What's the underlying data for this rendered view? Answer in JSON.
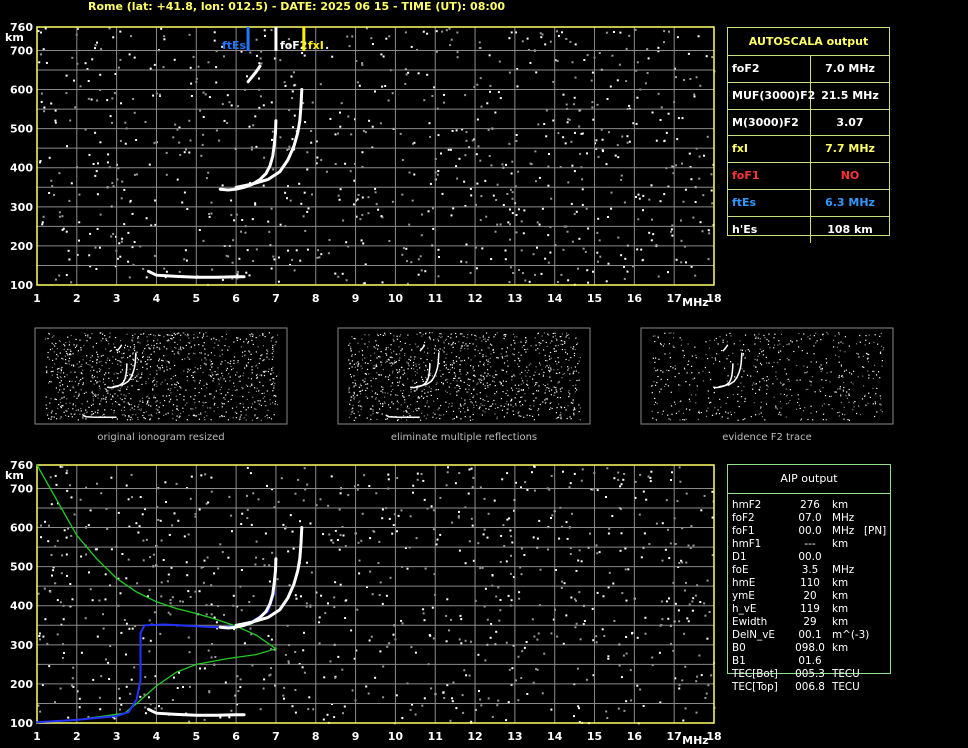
{
  "header": {
    "title": "Rome (lat: +41.8, lon: 012.5) - DATE: 2025 06 15 - TIME (UT): 08:00"
  },
  "colors": {
    "grid": "#8a8a8a",
    "frame": "#ffff66",
    "trace": "#ffffff",
    "profile_blue": "#2233ff",
    "profile_green": "#22cc22",
    "ftEs_marker": "#2277ff",
    "foF2_marker": "#ffffff",
    "fxI_marker": "#ffee00"
  },
  "main_ionogram": {
    "y_unit": "km",
    "x_unit": "MHz",
    "markers": [
      "ftEs",
      "foF2",
      "fxI"
    ]
  },
  "autoscala": {
    "title": "AUTOSCALA output",
    "rows": [
      {
        "label": "foF2",
        "value": "7.0 MHz",
        "color": "#ffffff"
      },
      {
        "label": "MUF(3000)F2",
        "value": "21.5 MHz",
        "color": "#ffffff"
      },
      {
        "label": "M(3000)F2",
        "value": "3.07",
        "color": "#ffffff"
      },
      {
        "label": "fxI",
        "value": "7.7 MHz",
        "color": "#ffff66"
      },
      {
        "label": "foF1",
        "value": "NO",
        "color": "#ff3333"
      },
      {
        "label": "ftEs",
        "value": "6.3 MHz",
        "color": "#3399ff"
      },
      {
        "label": "h'Es",
        "value": "108     km",
        "color": "#ffffff"
      }
    ]
  },
  "thumbnails": [
    {
      "caption": "original ionogram resized"
    },
    {
      "caption": "eliminate multiple reflections"
    },
    {
      "caption": "evidence F2 trace"
    }
  ],
  "aip": {
    "title": "AIP output",
    "rows": [
      {
        "name": "hmF2",
        "value": "276",
        "unit": "km",
        "extra": ""
      },
      {
        "name": "foF2",
        "value": "07.0",
        "unit": "MHz",
        "extra": ""
      },
      {
        "name": "foF1",
        "value": "00.0",
        "unit": "MHz",
        "extra": "[PN]"
      },
      {
        "name": "hmF1",
        "value": "---",
        "unit": "km",
        "extra": ""
      },
      {
        "name": "D1",
        "value": "00.0",
        "unit": "",
        "extra": ""
      },
      {
        "name": "foE",
        "value": "3.5",
        "unit": "MHz",
        "extra": ""
      },
      {
        "name": "hmE",
        "value": "110",
        "unit": "km",
        "extra": ""
      },
      {
        "name": "ymE",
        "value": "20",
        "unit": "km",
        "extra": ""
      },
      {
        "name": "h_vE",
        "value": "119",
        "unit": "km",
        "extra": ""
      },
      {
        "name": "Ewidth",
        "value": "29",
        "unit": "km",
        "extra": ""
      },
      {
        "name": "DelN_vE",
        "value": "00.1",
        "unit": "m^(-3)",
        "extra": ""
      },
      {
        "name": "B0",
        "value": "098.0",
        "unit": "km",
        "extra": ""
      },
      {
        "name": "B1",
        "value": "01.6",
        "unit": "",
        "extra": ""
      },
      {
        "name": "TEC[Bot]",
        "value": "005.3",
        "unit": "TECU",
        "extra": ""
      },
      {
        "name": "TEC[Top]",
        "value": "006.8",
        "unit": "TECU",
        "extra": ""
      }
    ]
  },
  "chart_data": [
    {
      "type": "scatter",
      "title": "",
      "xlabel": "MHz",
      "ylabel": "km",
      "xlim": [
        1,
        18
      ],
      "ylim": [
        100,
        760
      ],
      "x_ticks": [
        1,
        2,
        3,
        4,
        5,
        6,
        7,
        8,
        9,
        10,
        11,
        12,
        13,
        14,
        15,
        16,
        17,
        18
      ],
      "y_ticks": [
        100,
        200,
        300,
        400,
        500,
        600,
        700,
        760
      ],
      "grid": true,
      "vertical_markers": [
        {
          "name": "ftEs",
          "x": 6.3
        },
        {
          "name": "foF2",
          "x": 7.0
        },
        {
          "name": "fxI",
          "x": 7.7
        }
      ],
      "series": [
        {
          "name": "",
          "points": [
            [
              5.6,
              345
            ],
            [
              5.8,
              343
            ],
            [
              6.0,
              345
            ],
            [
              6.2,
              350
            ],
            [
              6.4,
              357
            ],
            [
              6.6,
              370
            ],
            [
              6.75,
              385
            ],
            [
              6.85,
              405
            ],
            [
              6.92,
              430
            ],
            [
              6.96,
              460
            ],
            [
              6.99,
              490
            ],
            [
              7.0,
              520
            ]
          ]
        },
        {
          "name": "",
          "points": [
            [
              6.0,
              350
            ],
            [
              6.4,
              358
            ],
            [
              6.8,
              370
            ],
            [
              7.1,
              390
            ],
            [
              7.3,
              420
            ],
            [
              7.45,
              455
            ],
            [
              7.55,
              490
            ],
            [
              7.6,
              520
            ],
            [
              7.63,
              560
            ],
            [
              7.65,
              600
            ]
          ]
        },
        {
          "name": "",
          "points": [
            [
              3.8,
              135
            ],
            [
              4.0,
              125
            ],
            [
              4.5,
              122
            ],
            [
              5.0,
              120
            ],
            [
              5.5,
              120
            ],
            [
              6.0,
              121
            ],
            [
              6.2,
              121
            ]
          ]
        },
        {
          "name": "",
          "points": [
            [
              6.3,
              620
            ],
            [
              6.5,
              645
            ],
            [
              6.6,
              660
            ]
          ]
        }
      ]
    },
    {
      "type": "line",
      "title": "",
      "xlabel": "MHz",
      "ylabel": "km",
      "xlim": [
        1,
        18
      ],
      "ylim": [
        100,
        760
      ],
      "grid": true,
      "series": [
        {
          "name": "",
          "points": [
            [
              1,
              760
            ],
            [
              1.5,
              670
            ],
            [
              2,
              580
            ],
            [
              2.5,
              520
            ],
            [
              3,
              470
            ],
            [
              3.5,
              435
            ],
            [
              4,
              410
            ],
            [
              4.5,
              393
            ],
            [
              5,
              380
            ],
            [
              5.5,
              365
            ],
            [
              6,
              348
            ],
            [
              6.5,
              325
            ],
            [
              7,
              290
            ],
            [
              6.5,
              275
            ],
            [
              5.8,
              265
            ],
            [
              5,
              250
            ],
            [
              4.5,
              230
            ],
            [
              4,
              195
            ],
            [
              3.5,
              150
            ],
            [
              3.2,
              125
            ],
            [
              2,
              108
            ],
            [
              1,
              102
            ]
          ]
        },
        {
          "name": "",
          "points": [
            [
              1,
              102
            ],
            [
              2,
              108
            ],
            [
              3,
              118
            ],
            [
              3.3,
              128
            ],
            [
              3.5,
              160
            ],
            [
              3.6,
              210
            ],
            [
              3.6,
              270
            ],
            [
              3.6,
              330
            ],
            [
              3.7,
              350
            ],
            [
              4.2,
              352
            ],
            [
              5.5,
              345
            ],
            [
              6.2,
              348
            ],
            [
              6.8,
              385
            ],
            [
              6.95,
              430
            ],
            [
              7.0,
              520
            ]
          ]
        },
        {
          "name": "",
          "points": [
            [
              5.6,
              345
            ],
            [
              5.8,
              343
            ],
            [
              6.0,
              345
            ],
            [
              6.2,
              350
            ],
            [
              6.4,
              357
            ],
            [
              6.6,
              370
            ],
            [
              6.75,
              385
            ],
            [
              6.85,
              405
            ],
            [
              6.92,
              430
            ],
            [
              6.96,
              460
            ],
            [
              6.99,
              490
            ],
            [
              7.0,
              520
            ]
          ]
        },
        {
          "name": "",
          "points": [
            [
              6.0,
              350
            ],
            [
              6.4,
              358
            ],
            [
              6.8,
              370
            ],
            [
              7.1,
              390
            ],
            [
              7.3,
              420
            ],
            [
              7.45,
              455
            ],
            [
              7.55,
              490
            ],
            [
              7.6,
              520
            ],
            [
              7.63,
              560
            ],
            [
              7.65,
              600
            ]
          ]
        },
        {
          "name": "",
          "points": [
            [
              3.8,
              135
            ],
            [
              4.0,
              125
            ],
            [
              4.5,
              122
            ],
            [
              5.0,
              120
            ],
            [
              5.5,
              120
            ],
            [
              6.0,
              121
            ],
            [
              6.2,
              121
            ]
          ]
        }
      ]
    }
  ]
}
